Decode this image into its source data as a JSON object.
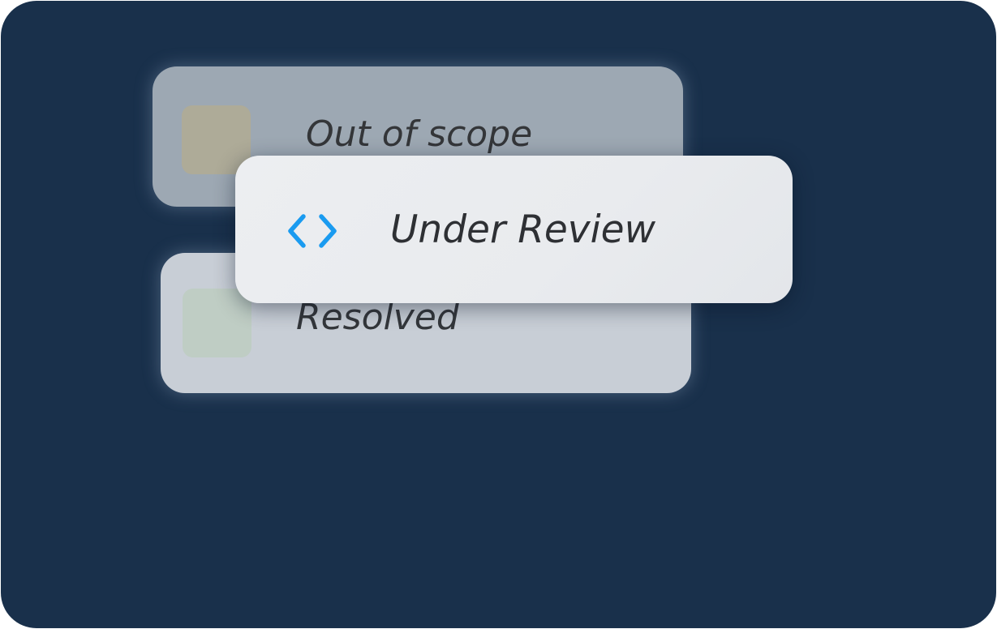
{
  "status_options": {
    "out_of_scope": {
      "label": "Out of scope",
      "swatch_color": "#aeab98"
    },
    "under_review": {
      "label": "Under Review",
      "icon": "code-brackets-icon",
      "icon_color": "#1a9bf0"
    },
    "resolved": {
      "label": "Resolved",
      "swatch_color": "#bfcdc4"
    }
  }
}
